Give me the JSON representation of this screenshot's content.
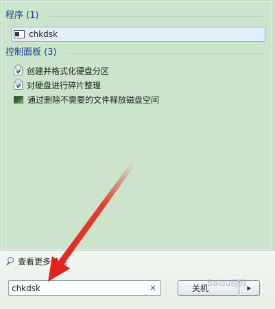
{
  "programs": {
    "heading": "程序 (1)",
    "items": [
      {
        "label": "chkdsk",
        "icon": "command-prompt-icon"
      }
    ]
  },
  "control_panel": {
    "heading": "控制面板 (3)",
    "items": [
      {
        "label": "创建并格式化硬盘分区",
        "icon": "control-panel-tool-icon"
      },
      {
        "label": "对硬盘进行碎片整理",
        "icon": "control-panel-tool-icon"
      },
      {
        "label": "通过删除不需要的文件释放磁盘空间",
        "icon": "disk-cleanup-icon"
      }
    ]
  },
  "see_more": "查看更多结果",
  "search": {
    "value": "chkdsk",
    "clear_icon": "×"
  },
  "shutdown": {
    "label": "关机",
    "arrow": "▶"
  },
  "watermark": "Baidu经验",
  "colors": {
    "results_background": "#cbe4cb",
    "heading_text": "#1d3f8e",
    "selection_border": "#8fb6e3",
    "annotation_arrow": "#e2231a"
  }
}
